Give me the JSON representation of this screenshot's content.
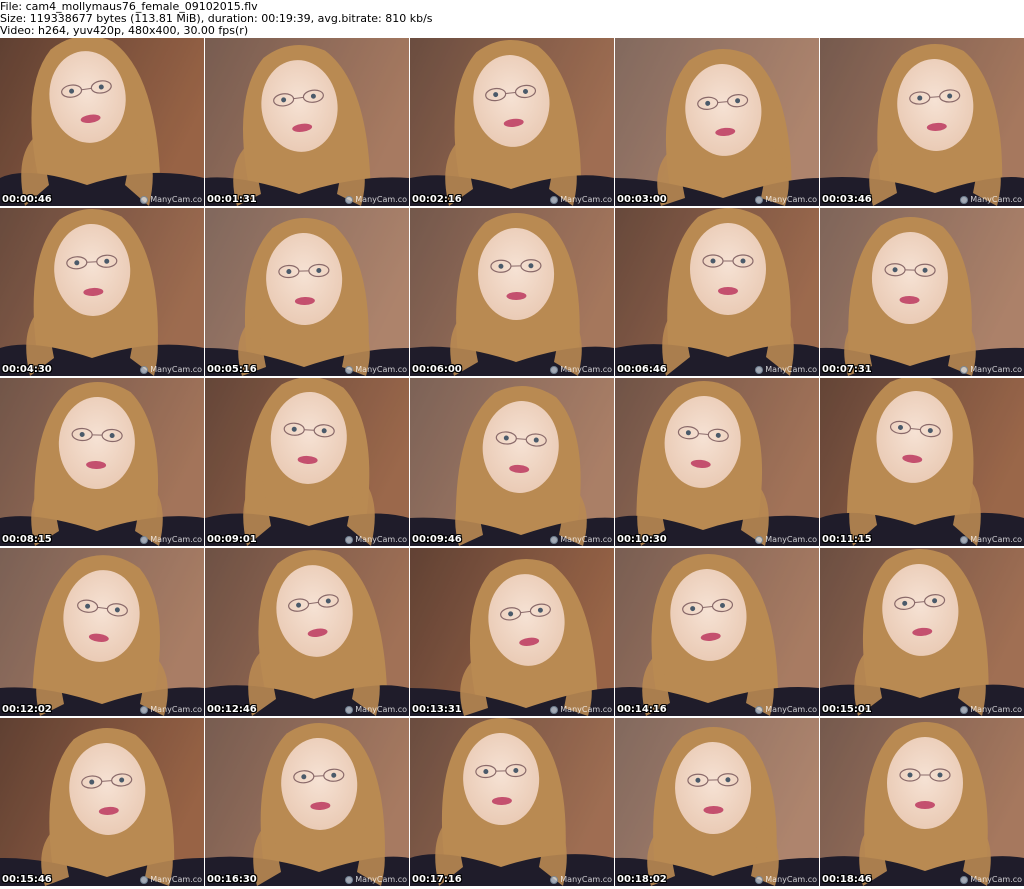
{
  "header": {
    "file_line": "File: cam4_mollymaus76_female_09102015.flv",
    "size_line": "Size: 119338677 bytes (113.81 MiB), duration: 00:19:39, avg.bitrate: 810 kb/s",
    "video_line": "Video: h264, yuv420p, 480x400, 30.00 fps(r)"
  },
  "watermark_text": "ManyCam.co",
  "colors": {
    "background": "#ffffff",
    "frame_wall": "#6b3a22",
    "hair": "#b98a52",
    "skin": "#e9c9b3",
    "top": "#1f1c2a"
  },
  "thumbnails": [
    {
      "timestamp": "00:00:46"
    },
    {
      "timestamp": "00:01:31"
    },
    {
      "timestamp": "00:02:16"
    },
    {
      "timestamp": "00:03:00"
    },
    {
      "timestamp": "00:03:46"
    },
    {
      "timestamp": "00:04:30"
    },
    {
      "timestamp": "00:05:16"
    },
    {
      "timestamp": "00:06:00"
    },
    {
      "timestamp": "00:06:46"
    },
    {
      "timestamp": "00:07:31"
    },
    {
      "timestamp": "00:08:15"
    },
    {
      "timestamp": "00:09:01"
    },
    {
      "timestamp": "00:09:46"
    },
    {
      "timestamp": "00:10:30"
    },
    {
      "timestamp": "00:11:15"
    },
    {
      "timestamp": "00:12:02"
    },
    {
      "timestamp": "00:12:46"
    },
    {
      "timestamp": "00:13:31"
    },
    {
      "timestamp": "00:14:16"
    },
    {
      "timestamp": "00:15:01"
    },
    {
      "timestamp": "00:15:46"
    },
    {
      "timestamp": "00:16:30"
    },
    {
      "timestamp": "00:17:16"
    },
    {
      "timestamp": "00:18:02"
    },
    {
      "timestamp": "00:18:46"
    }
  ]
}
